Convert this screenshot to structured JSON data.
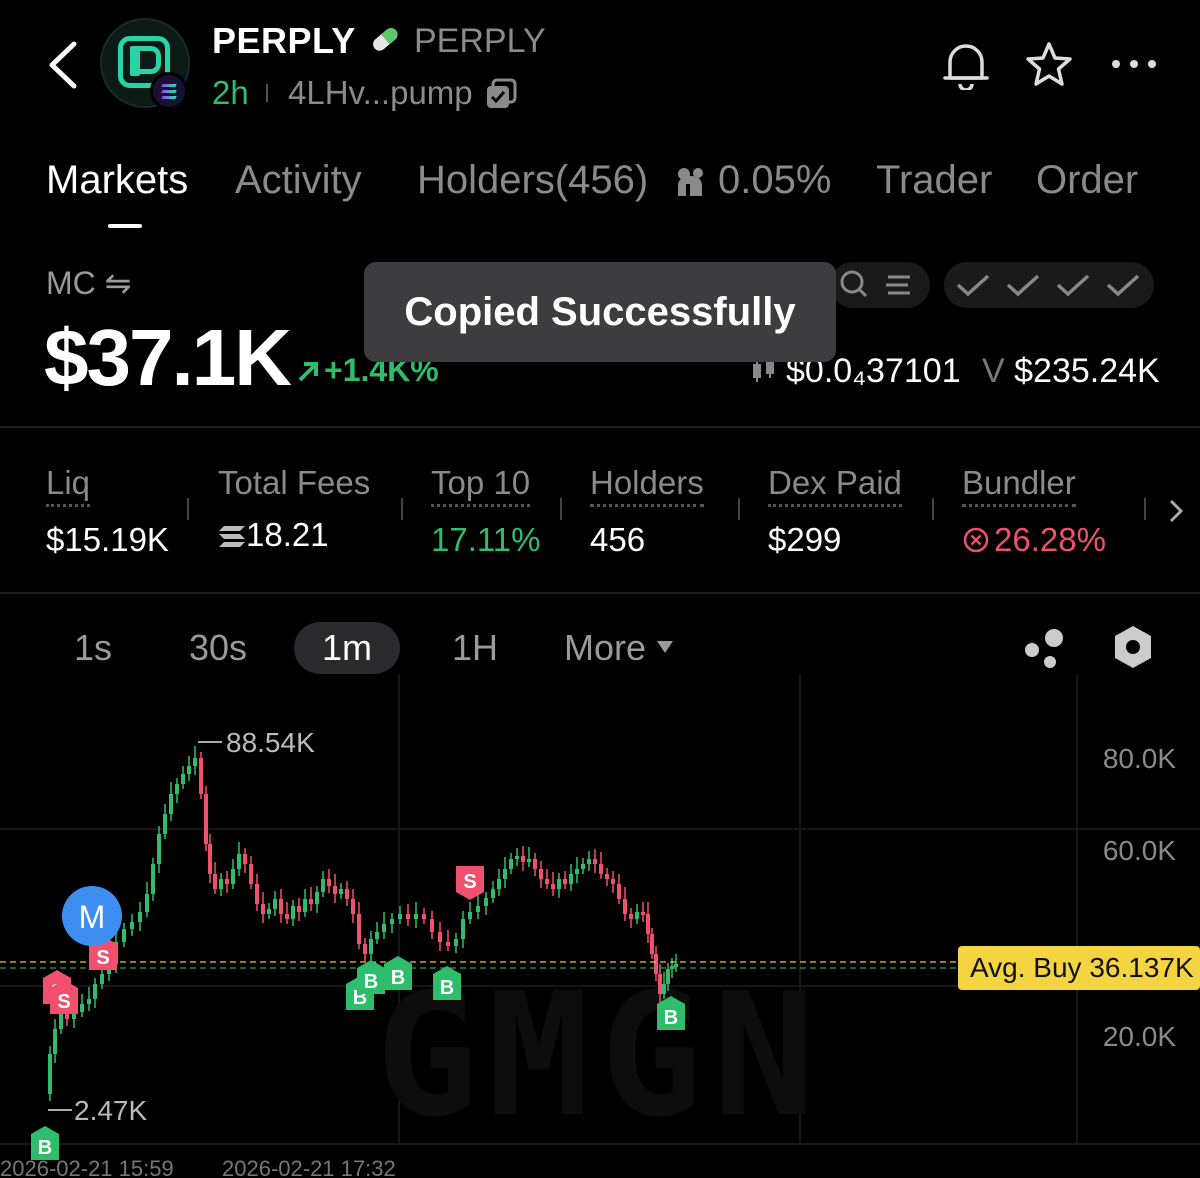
{
  "header": {
    "token_name": "PERPLY",
    "token_symbol": "PERPLY",
    "age": "2h",
    "address": "4LHv...pump"
  },
  "tabs": [
    {
      "label": "Markets",
      "active": true
    },
    {
      "label": "Activity",
      "active": false
    },
    {
      "label": "Holders(456)",
      "active": false
    },
    {
      "label": "0.05%",
      "active": false
    },
    {
      "label": "Trader",
      "active": false
    },
    {
      "label": "Order",
      "active": false
    }
  ],
  "market": {
    "mc_label": "MC ⇋",
    "mc_value": "$37.1K",
    "mc_change": "+1.4K%",
    "price": "$0.0₄37101",
    "volume_prefix": "V",
    "volume": "$235.24K"
  },
  "toast": "Copied Successfully",
  "stats": [
    {
      "label": "Liq",
      "value": "$15.19K"
    },
    {
      "label": "Total Fees",
      "value": "18.21"
    },
    {
      "label": "Top 10",
      "value": "17.11%"
    },
    {
      "label": "Holders",
      "value": "456"
    },
    {
      "label": "Dex Paid",
      "value": "$299"
    },
    {
      "label": "Bundler",
      "value": "26.28%"
    }
  ],
  "timeframes": [
    {
      "label": "1s",
      "active": false
    },
    {
      "label": "30s",
      "active": false
    },
    {
      "label": "1m",
      "active": true
    },
    {
      "label": "1H",
      "active": false
    }
  ],
  "more_label": "More",
  "colors": {
    "up": "#2ebd6b",
    "down": "#f0506e",
    "accent_yellow": "#f5d442",
    "marker_blue": "#3d8ef0"
  },
  "chart": {
    "y_ticks": [
      "80.0K",
      "60.0K",
      "20.0K"
    ],
    "high_label": "88.54K",
    "low_label": "2.47K",
    "avg_buy_label": "Avg. Buy 36.137K",
    "x_ticks": [
      "2026-02-21 15:59",
      "2026-02-21 17:32"
    ],
    "watermark": "GMGN",
    "marker_buy": "B",
    "marker_sell": "S",
    "marker_migrate": "M"
  }
}
